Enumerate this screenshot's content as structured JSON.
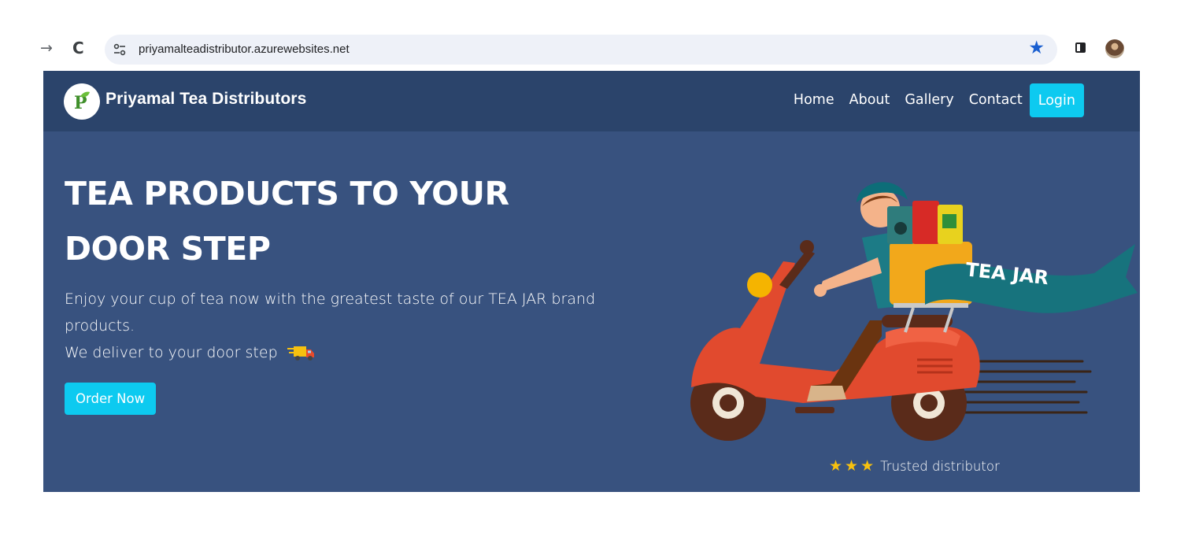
{
  "browser": {
    "url": "priyamalteadistributor.azurewebsites.net",
    "icons": [
      "forward-arrow-icon",
      "reload-icon",
      "site-info-icon",
      "bookmark-star-icon",
      "side-panel-icon",
      "profile-avatar"
    ]
  },
  "site": {
    "brand": "Priyamal Tea Distributors",
    "nav": {
      "home": "Home",
      "about": "About",
      "gallery": "Gallery",
      "contact": "Contact",
      "login": "Login"
    },
    "hero": {
      "heading_line1": "TEA PRODUCTS TO YOUR",
      "heading_line2": "DOOR STEP",
      "line1": "Enjoy your cup of tea now with the greatest taste of our TEA JAR brand products.",
      "line2": "We deliver to your door step",
      "order_button": "Order Now",
      "banner_text": "TEA  JAR",
      "trust_text": "Trusted distributor",
      "trust_stars": 3
    }
  },
  "colors": {
    "header_bg": "#2b446b",
    "hero_bg": "#38527f",
    "accent": "#0dcaf0",
    "star": "#f7c10f"
  }
}
